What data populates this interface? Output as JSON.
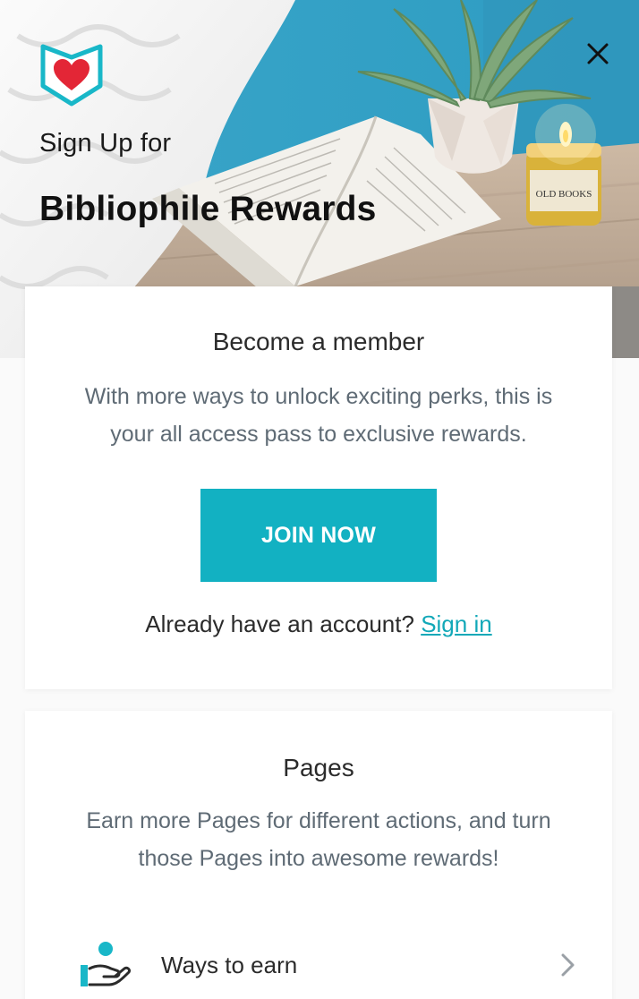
{
  "header": {
    "subtitle": "Sign Up for",
    "title": "Bibliophile Rewards",
    "logo_icon": "heart-shield-icon",
    "close_icon": "close-icon"
  },
  "member_card": {
    "title": "Become a member",
    "body": "With more ways to unlock exciting perks, this is your all access pass to exclusive rewards.",
    "join_label": "JOIN NOW",
    "signin_prompt": "Already have an account?",
    "signin_link": "Sign in"
  },
  "pages_card": {
    "title": "Pages",
    "body": "Earn more Pages for different actions, and turn those Pages into awesome rewards!",
    "earn_label": "Ways to earn",
    "earn_icon": "hand-coin-icon",
    "chevron_icon": "chevron-right-icon"
  },
  "colors": {
    "accent": "#12b1c2",
    "heart": "#e32636",
    "shield": "#19b7c8"
  },
  "photo": {
    "candle_label": "OLD BOOKS"
  }
}
